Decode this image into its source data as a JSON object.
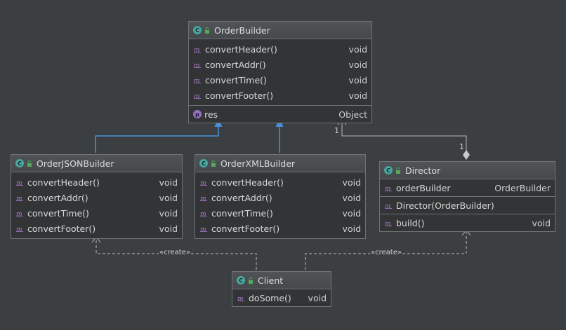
{
  "classes": {
    "order_builder": {
      "name": "OrderBuilder",
      "methods": [
        {
          "name": "convertHeader()",
          "type": "void"
        },
        {
          "name": "convertAddr()",
          "type": "void"
        },
        {
          "name": "convertTime()",
          "type": "void"
        },
        {
          "name": "convertFooter()",
          "type": "void"
        }
      ],
      "properties": [
        {
          "name": "res",
          "type": "Object"
        }
      ]
    },
    "order_json_builder": {
      "name": "OrderJSONBuilder",
      "methods": [
        {
          "name": "convertHeader()",
          "type": "void"
        },
        {
          "name": "convertAddr()",
          "type": "void"
        },
        {
          "name": "convertTime()",
          "type": "void"
        },
        {
          "name": "convertFooter()",
          "type": "void"
        }
      ]
    },
    "order_xml_builder": {
      "name": "OrderXMLBuilder",
      "methods": [
        {
          "name": "convertHeader()",
          "type": "void"
        },
        {
          "name": "convertAddr()",
          "type": "void"
        },
        {
          "name": "convertTime()",
          "type": "void"
        },
        {
          "name": "convertFooter()",
          "type": "void"
        }
      ]
    },
    "director": {
      "name": "Director",
      "fields": [
        {
          "name": "orderBuilder",
          "type": "OrderBuilder"
        }
      ],
      "constructors": [
        {
          "name": "Director(OrderBuilder)",
          "type": ""
        }
      ],
      "methods": [
        {
          "name": "build()",
          "type": "void"
        }
      ]
    },
    "client": {
      "name": "Client",
      "methods": [
        {
          "name": "doSome()",
          "type": "void"
        }
      ]
    }
  },
  "relations": {
    "create_label_left": "«create»",
    "create_label_right": "«create»",
    "aggregation_mult_target": "1",
    "aggregation_mult_source": "1"
  },
  "colors": {
    "background": "#3b3f42",
    "inheritance": "#4a90d9",
    "connector": "#b8b8b8",
    "class_icon": "#49a7a0",
    "property_icon": "#9a6fc1"
  },
  "icons": {
    "class": "class-c-icon",
    "visibility": "public-lock-icon",
    "method": "method-m-icon",
    "property": "property-p-icon"
  }
}
